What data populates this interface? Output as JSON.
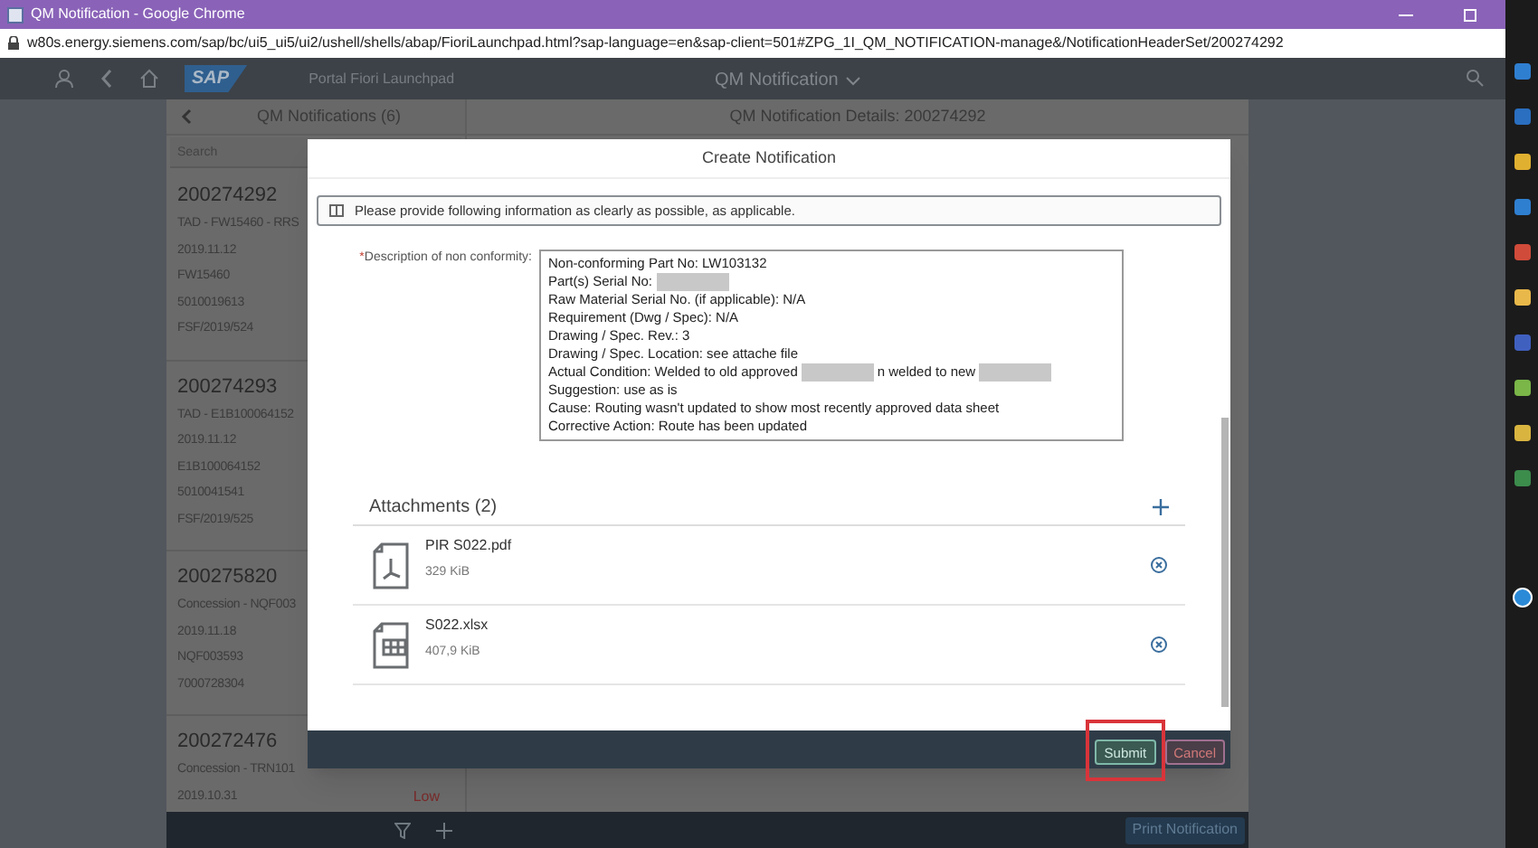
{
  "browser": {
    "title": "QM Notification - Google Chrome",
    "url": "w80s.energy.siemens.com/sap/bc/ui5_ui5/ui2/ushell/shells/abap/FioriLaunchpad.html?sap-language=en&sap-client=501#ZPG_1I_QM_NOTIFICATION-manage&/NotificationHeaderSet/200274292"
  },
  "shell": {
    "logo": "SAP",
    "title": "Portal Fiori Launchpad",
    "app_title": "QM Notification"
  },
  "master": {
    "title": "QM Notifications (6)",
    "search": {
      "placeholder": "Search"
    },
    "items": [
      {
        "number": "200274292",
        "lines": [
          "TAD - FW15460 - RRS",
          "2019.11.12",
          "FW15460",
          "5010019613",
          "FSF/2019/524"
        ]
      },
      {
        "number": "200274293",
        "lines": [
          "TAD - E1B100064152",
          "2019.11.12",
          "E1B100064152",
          "5010041541",
          "FSF/2019/525"
        ]
      },
      {
        "number": "200275820",
        "lines": [
          "Concession - NQF003",
          "2019.11.18",
          "NQF003593",
          "7000728304"
        ]
      },
      {
        "number": "200272476",
        "lines": [
          "Concession - TRN101",
          "2019.10.31"
        ],
        "priority": "Low"
      }
    ]
  },
  "detail": {
    "title": "QM Notification Details: 200274292"
  },
  "dialog": {
    "title": "Create Notification",
    "info": "Please provide following information as clearly as possible, as applicable.",
    "field_label": "Description of non conformity:",
    "required_marker": "*",
    "description_lines": [
      [
        {
          "kind": "text",
          "text": "Non-conforming Part No: LW103132"
        }
      ],
      [
        {
          "kind": "text",
          "text": "Part(s) Serial No:"
        },
        {
          "kind": "redacted"
        }
      ],
      [
        {
          "kind": "text",
          "text": "Raw Material Serial No. (if applicable): N/A"
        }
      ],
      [
        {
          "kind": "text",
          "text": "Requirement (Dwg / Spec): N/A"
        }
      ],
      [
        {
          "kind": "text",
          "text": "Drawing / Spec. Rev.: 3"
        }
      ],
      [
        {
          "kind": "text",
          "text": "Drawing / Spec. Location: see attache file"
        }
      ],
      [
        {
          "kind": "text",
          "text": "Actual Condition: Welded to old approved"
        },
        {
          "kind": "redacted"
        },
        {
          "kind": "text",
          "text": "n welded to new"
        },
        {
          "kind": "redacted"
        }
      ],
      [
        {
          "kind": "text",
          "text": "Suggestion: use as is"
        }
      ],
      [
        {
          "kind": "text",
          "text": "Cause: Routing wasn't updated to show most recently approved data sheet"
        }
      ],
      [
        {
          "kind": "text",
          "text": "Corrective Action: Route has been updated"
        }
      ]
    ],
    "attachments": {
      "title": "Attachments (2)",
      "items": [
        {
          "name": "PIR S022.pdf",
          "size": "329 KiB",
          "kind": "pdf"
        },
        {
          "name": "S022.xlsx",
          "size": "407,9 KiB",
          "kind": "spreadsheet"
        }
      ]
    },
    "buttons": [
      {
        "label": "Submit",
        "kind": "accept",
        "highlighted": true
      },
      {
        "label": "Cancel",
        "kind": "reject",
        "highlighted": false
      }
    ]
  },
  "footer": {
    "print_button": "Print Notification"
  }
}
